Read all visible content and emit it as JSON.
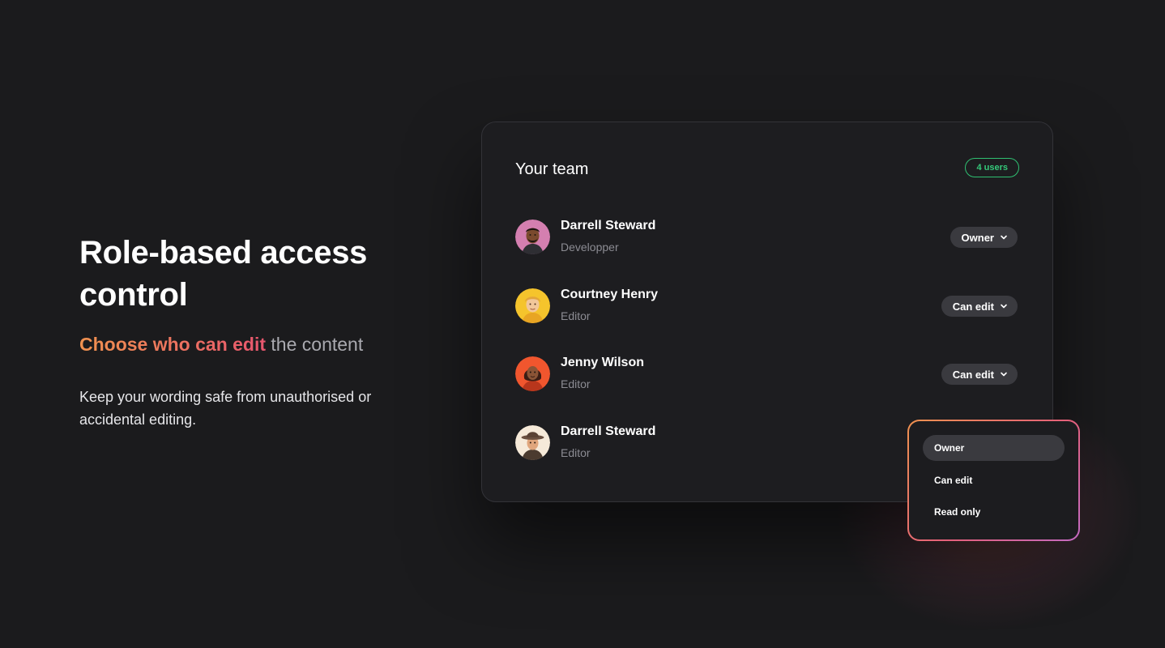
{
  "hero": {
    "title": "Role-based access control",
    "subtitle_accent": "Choose who can edit",
    "subtitle_rest": "the content",
    "body": "Keep your wording safe from unauthorised or accidental editing."
  },
  "team": {
    "title": "Your team",
    "users_badge": "4 users",
    "members": [
      {
        "name": "Darrell Steward",
        "role": "Developper",
        "permission": "Owner",
        "avatar_color": "#d47fb0"
      },
      {
        "name": "Courtney Henry",
        "role": "Editor",
        "permission": "Can edit",
        "avatar_color": "#f5c42c"
      },
      {
        "name": "Jenny Wilson",
        "role": "Editor",
        "permission": "Can edit",
        "avatar_color": "#f0562e"
      },
      {
        "name": "Darrell Steward",
        "role": "Editor",
        "permission": "Owner",
        "avatar_color": "#f6ead9"
      }
    ]
  },
  "dropdown": {
    "options": [
      "Owner",
      "Can edit",
      "Read only"
    ],
    "selected": "Owner"
  },
  "colors": {
    "background": "#1b1b1d",
    "badge_green": "#35c97a",
    "accent_orange": "#f0924f",
    "accent_pink": "#e8566e"
  },
  "icons": [
    "chevron-down-icon",
    "avatar"
  ]
}
